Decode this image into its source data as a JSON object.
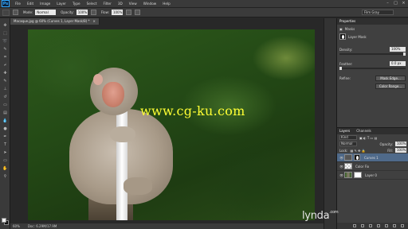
{
  "menubar": {
    "app_logo": "Ps",
    "items": [
      "File",
      "Edit",
      "Image",
      "Layer",
      "Type",
      "Select",
      "Filter",
      "3D",
      "View",
      "Window",
      "Help"
    ],
    "workspace": "Film Gray"
  },
  "options": {
    "mode_label": "Mode:",
    "mode_value": "Normal",
    "opacity_label": "Opacity:",
    "opacity_value": "100%",
    "flow_label": "Flow:",
    "flow_value": "100%"
  },
  "document": {
    "tab_title": "Macaque.jpg @ 60% (Curves 1, Layer Mask/8) *",
    "watermark": "www.cg-ku.com",
    "zoom": "60%",
    "doc_info": "Doc: 6.29M/17.9M"
  },
  "properties": {
    "tabs": [
      "Properties"
    ],
    "section": "Masks",
    "mask_label": "Layer Mask",
    "density_label": "Density:",
    "density_value": "100%",
    "feather_label": "Feather:",
    "feather_value": "0.0 px",
    "refine_label": "Refine:",
    "mask_edge_button": "Mask Edge...",
    "color_range_button": "Color Range..."
  },
  "layers": {
    "tabs": [
      "Layers",
      "Channels"
    ],
    "kind_label": "Kind",
    "blend_mode": "Normal",
    "opacity_label": "Opacity:",
    "opacity_value": "100%",
    "lock_label": "Lock:",
    "fill_label": "Fill:",
    "fill_value": "100%",
    "rows": [
      {
        "name": "Curves 1",
        "active": true
      },
      {
        "name": "Color Fix",
        "active": false
      },
      {
        "name": "Layer 0",
        "active": false
      }
    ]
  },
  "branding": {
    "logo": "lynda",
    "logo_tld": ".com"
  },
  "colors": {
    "ui_dark": "#282828",
    "panel": "#404040",
    "watermark": "#ffff33",
    "selected_layer": "#4f6a8a"
  }
}
